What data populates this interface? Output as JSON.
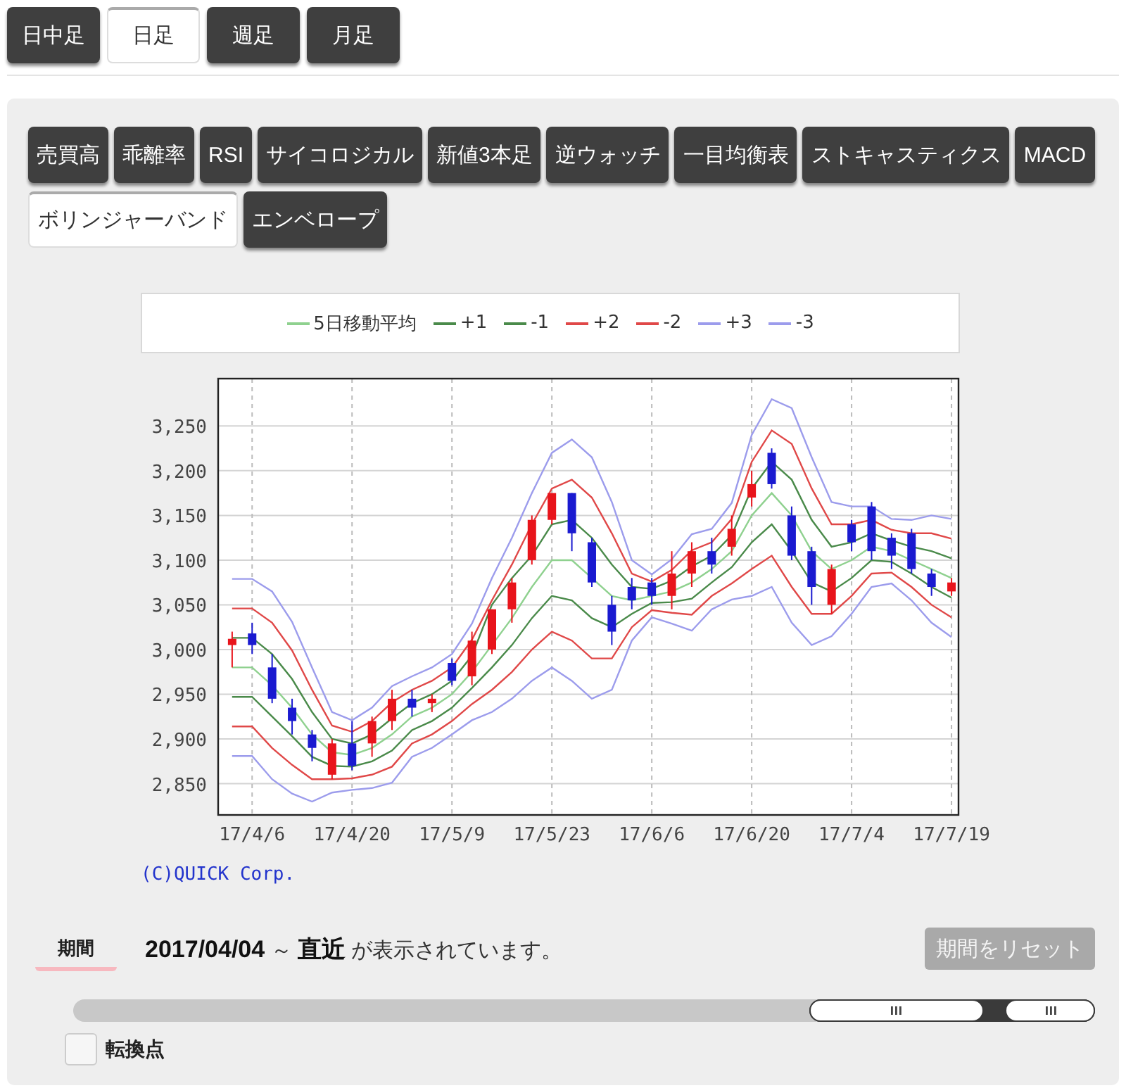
{
  "timeframe_tabs": [
    {
      "label": "日中足",
      "selected": false
    },
    {
      "label": "日足",
      "selected": true
    },
    {
      "label": "週足",
      "selected": false
    },
    {
      "label": "月足",
      "selected": false
    }
  ],
  "indicator_tabs": [
    {
      "label": "売買高",
      "selected": false
    },
    {
      "label": "乖離率",
      "selected": false
    },
    {
      "label": "RSI",
      "selected": false
    },
    {
      "label": "サイコロジカル",
      "selected": false
    },
    {
      "label": "新値3本足",
      "selected": false
    },
    {
      "label": "逆ウォッチ",
      "selected": false
    },
    {
      "label": "一目均衡表",
      "selected": false
    },
    {
      "label": "ストキャスティクス",
      "selected": false
    },
    {
      "label": "MACD",
      "selected": false
    },
    {
      "label": "ボリンジャーバンド",
      "selected": true
    },
    {
      "label": "エンベロープ",
      "selected": false
    }
  ],
  "chart": {
    "chart_data": {
      "type": "candlestick",
      "grid": true,
      "categories": [
        null,
        "17/4/6",
        null,
        null,
        null,
        null,
        "17/4/20",
        null,
        null,
        null,
        null,
        "17/5/9",
        null,
        null,
        null,
        null,
        "17/5/23",
        null,
        null,
        null,
        null,
        "17/6/6",
        null,
        null,
        null,
        null,
        "17/6/20",
        null,
        null,
        null,
        null,
        "17/7/4",
        null,
        null,
        null,
        null,
        "17/7/19"
      ],
      "ylim": [
        2815,
        3303
      ],
      "yticks": [
        {
          "value": 2850,
          "label": "2,850"
        },
        {
          "value": 2900,
          "label": "2,900"
        },
        {
          "value": 2950,
          "label": "2,950"
        },
        {
          "value": 3000,
          "label": "3,000"
        },
        {
          "value": 3050,
          "label": "3,050"
        },
        {
          "value": 3100,
          "label": "3,100"
        },
        {
          "value": 3150,
          "label": "3,150"
        },
        {
          "value": 3200,
          "label": "3,200"
        },
        {
          "value": 3250,
          "label": "3,250"
        }
      ],
      "series": [
        {
          "name": "5日移動平均",
          "type": "line",
          "color": "#8fd18f",
          "values": [
            2980,
            2980,
            2960,
            2935,
            2905,
            2885,
            2882,
            2890,
            2905,
            2925,
            2935,
            2950,
            2975,
            3005,
            3035,
            3070,
            3100,
            3100,
            3080,
            3060,
            3055,
            3060,
            3065,
            3075,
            3090,
            3110,
            3150,
            3175,
            3150,
            3110,
            3090,
            3100,
            3115,
            3110,
            3100,
            3090,
            3080
          ]
        },
        {
          "name": "+1",
          "type": "line",
          "color": "#4a8a4a",
          "values": [
            3013,
            3013,
            2995,
            2967,
            2930,
            2900,
            2895,
            2905,
            2923,
            2940,
            2950,
            2965,
            2993,
            3050,
            3080,
            3105,
            3140,
            3145,
            3125,
            3095,
            3070,
            3068,
            3077,
            3093,
            3105,
            3128,
            3180,
            3210,
            3190,
            3145,
            3115,
            3120,
            3130,
            3122,
            3115,
            3110,
            3102
          ]
        },
        {
          "name": "-1",
          "type": "line",
          "color": "#4a8a4a",
          "values": [
            2947,
            2947,
            2925,
            2903,
            2880,
            2870,
            2869,
            2875,
            2887,
            2910,
            2920,
            2935,
            2957,
            2980,
            3005,
            3035,
            3060,
            3055,
            3035,
            3025,
            3040,
            3052,
            3053,
            3057,
            3075,
            3092,
            3120,
            3140,
            3110,
            3075,
            3065,
            3080,
            3100,
            3098,
            3085,
            3070,
            3058
          ]
        },
        {
          "name": "+2",
          "type": "line",
          "color": "#e04848",
          "values": [
            3046,
            3046,
            3030,
            2999,
            2955,
            2915,
            2908,
            2920,
            2941,
            2955,
            2965,
            2980,
            3011,
            3055,
            3095,
            3140,
            3180,
            3190,
            3170,
            3130,
            3085,
            3076,
            3089,
            3111,
            3120,
            3146,
            3210,
            3245,
            3230,
            3180,
            3140,
            3140,
            3145,
            3134,
            3130,
            3130,
            3124
          ]
        },
        {
          "name": "-2",
          "type": "line",
          "color": "#e04848",
          "values": [
            2914,
            2914,
            2890,
            2871,
            2855,
            2855,
            2856,
            2860,
            2869,
            2895,
            2905,
            2920,
            2939,
            2955,
            2975,
            3000,
            3020,
            3010,
            2990,
            2990,
            3025,
            3044,
            3041,
            3039,
            3060,
            3074,
            3090,
            3105,
            3070,
            3040,
            3040,
            3060,
            3085,
            3086,
            3070,
            3050,
            3036
          ]
        },
        {
          "name": "+3",
          "type": "line",
          "color": "#9c9cec",
          "values": [
            3079,
            3079,
            3065,
            3031,
            2980,
            2930,
            2921,
            2935,
            2959,
            2970,
            2980,
            2995,
            3029,
            3080,
            3125,
            3175,
            3220,
            3235,
            3215,
            3165,
            3100,
            3084,
            3101,
            3129,
            3135,
            3164,
            3240,
            3280,
            3270,
            3215,
            3165,
            3160,
            3160,
            3146,
            3145,
            3150,
            3146
          ]
        },
        {
          "name": "-3",
          "type": "line",
          "color": "#9c9cec",
          "values": [
            2881,
            2881,
            2855,
            2839,
            2830,
            2840,
            2843,
            2845,
            2851,
            2880,
            2890,
            2905,
            2921,
            2930,
            2945,
            2965,
            2980,
            2965,
            2945,
            2955,
            3010,
            3036,
            3029,
            3021,
            3045,
            3056,
            3060,
            3070,
            3030,
            3005,
            3015,
            3040,
            3070,
            3074,
            3055,
            3030,
            3014
          ]
        }
      ],
      "ohlc": [
        [
          3005,
          3020,
          2980,
          3012
        ],
        [
          3018,
          3030,
          2995,
          3005
        ],
        [
          2980,
          2995,
          2940,
          2945
        ],
        [
          2935,
          2945,
          2905,
          2920
        ],
        [
          2905,
          2910,
          2875,
          2890
        ],
        [
          2860,
          2900,
          2855,
          2895
        ],
        [
          2895,
          2920,
          2865,
          2870
        ],
        [
          2895,
          2925,
          2880,
          2920
        ],
        [
          2920,
          2955,
          2910,
          2945
        ],
        [
          2945,
          2955,
          2925,
          2935
        ],
        [
          2940,
          2950,
          2930,
          2945
        ],
        [
          2985,
          2990,
          2960,
          2965
        ],
        [
          2970,
          3020,
          2960,
          3010
        ],
        [
          3000,
          3045,
          2995,
          3045
        ],
        [
          3045,
          3080,
          3030,
          3075
        ],
        [
          3100,
          3150,
          3095,
          3145
        ],
        [
          3145,
          3175,
          3140,
          3175
        ],
        [
          3175,
          3175,
          3110,
          3130
        ],
        [
          3120,
          3125,
          3070,
          3075
        ],
        [
          3050,
          3060,
          3005,
          3020
        ],
        [
          3070,
          3080,
          3045,
          3055
        ],
        [
          3075,
          3080,
          3050,
          3060
        ],
        [
          3060,
          3110,
          3045,
          3085
        ],
        [
          3085,
          3120,
          3070,
          3110
        ],
        [
          3110,
          3125,
          3085,
          3095
        ],
        [
          3115,
          3150,
          3105,
          3135
        ],
        [
          3170,
          3200,
          3160,
          3185
        ],
        [
          3220,
          3225,
          3180,
          3185
        ],
        [
          3150,
          3160,
          3100,
          3105
        ],
        [
          3110,
          3115,
          3050,
          3070
        ],
        [
          3050,
          3095,
          3040,
          3090
        ],
        [
          3140,
          3145,
          3110,
          3120
        ],
        [
          3160,
          3165,
          3100,
          3110
        ],
        [
          3125,
          3130,
          3090,
          3105
        ],
        [
          3130,
          3135,
          3085,
          3090
        ],
        [
          3085,
          3090,
          3060,
          3070
        ],
        [
          3065,
          3080,
          3060,
          3075
        ]
      ]
    },
    "credit": "(C)QUICK Corp."
  },
  "period": {
    "label": "期間",
    "text": "**2017/04/04** ～ **直近** が表示されています。",
    "reset_button": {
      "label": "期間をリセット",
      "disabled": true
    },
    "slider": {
      "level": 0.28
    }
  },
  "checkbox": {
    "label": "転換点",
    "checked": false
  }
}
